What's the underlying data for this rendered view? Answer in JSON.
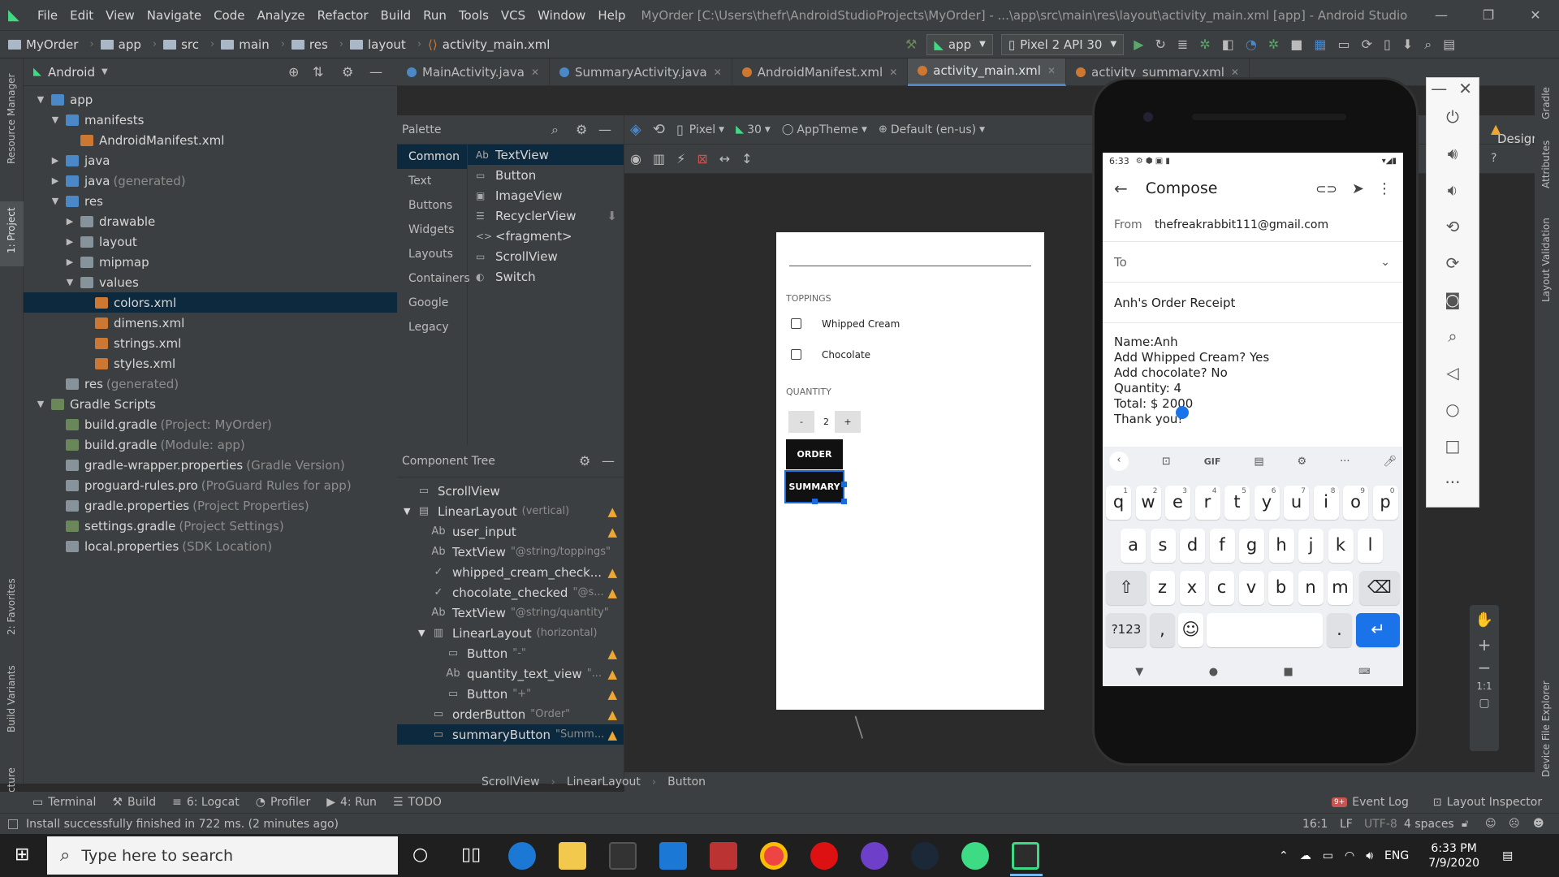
{
  "menu": {
    "items": [
      "File",
      "Edit",
      "View",
      "Navigate",
      "Code",
      "Analyze",
      "Refactor",
      "Build",
      "Run",
      "Tools",
      "VCS",
      "Window",
      "Help"
    ],
    "title": "MyOrder [C:\\Users\\thefr\\AndroidStudioProjects\\MyOrder] - ...\\app\\src\\main\\res\\layout\\activity_main.xml [app] - Android Studio"
  },
  "nav": {
    "crumbs": [
      "MyOrder",
      "app",
      "src",
      "main",
      "res",
      "layout",
      "activity_main.xml"
    ],
    "run_config": "app",
    "device": "Pixel 2 API 30"
  },
  "project": {
    "view": "Android",
    "tree": [
      {
        "label": "app",
        "extra": "",
        "depth": 0,
        "arrow": "▼",
        "type": "folder-blue"
      },
      {
        "label": "manifests",
        "extra": "",
        "depth": 1,
        "arrow": "▼",
        "type": "folder-blue"
      },
      {
        "label": "AndroidManifest.xml",
        "extra": "",
        "depth": 2,
        "arrow": "",
        "type": "xml"
      },
      {
        "label": "java",
        "extra": "",
        "depth": 1,
        "arrow": "▶",
        "type": "folder-blue"
      },
      {
        "label": "java",
        "extra": "(generated)",
        "depth": 1,
        "arrow": "▶",
        "type": "folder-blue"
      },
      {
        "label": "res",
        "extra": "",
        "depth": 1,
        "arrow": "▼",
        "type": "folder-blue"
      },
      {
        "label": "drawable",
        "extra": "",
        "depth": 2,
        "arrow": "▶",
        "type": "folder"
      },
      {
        "label": "layout",
        "extra": "",
        "depth": 2,
        "arrow": "▶",
        "type": "folder"
      },
      {
        "label": "mipmap",
        "extra": "",
        "depth": 2,
        "arrow": "▶",
        "type": "folder"
      },
      {
        "label": "values",
        "extra": "",
        "depth": 2,
        "arrow": "▼",
        "type": "folder"
      },
      {
        "label": "colors.xml",
        "extra": "",
        "depth": 3,
        "arrow": "",
        "type": "xml",
        "selected": true
      },
      {
        "label": "dimens.xml",
        "extra": "",
        "depth": 3,
        "arrow": "",
        "type": "xml"
      },
      {
        "label": "strings.xml",
        "extra": "",
        "depth": 3,
        "arrow": "",
        "type": "xml"
      },
      {
        "label": "styles.xml",
        "extra": "",
        "depth": 3,
        "arrow": "",
        "type": "xml"
      },
      {
        "label": "res",
        "extra": "(generated)",
        "depth": 1,
        "arrow": "",
        "type": "folder"
      },
      {
        "label": "Gradle Scripts",
        "extra": "",
        "depth": 0,
        "arrow": "▼",
        "type": "gradle"
      },
      {
        "label": "build.gradle",
        "extra": "(Project: MyOrder)",
        "depth": 1,
        "arrow": "",
        "type": "gradle"
      },
      {
        "label": "build.gradle",
        "extra": "(Module: app)",
        "depth": 1,
        "arrow": "",
        "type": "gradle"
      },
      {
        "label": "gradle-wrapper.properties",
        "extra": "(Gradle Version)",
        "depth": 1,
        "arrow": "",
        "type": "props"
      },
      {
        "label": "proguard-rules.pro",
        "extra": "(ProGuard Rules for app)",
        "depth": 1,
        "arrow": "",
        "type": "props"
      },
      {
        "label": "gradle.properties",
        "extra": "(Project Properties)",
        "depth": 1,
        "arrow": "",
        "type": "props"
      },
      {
        "label": "settings.gradle",
        "extra": "(Project Settings)",
        "depth": 1,
        "arrow": "",
        "type": "gradle"
      },
      {
        "label": "local.properties",
        "extra": "(SDK Location)",
        "depth": 1,
        "arrow": "",
        "type": "props"
      }
    ]
  },
  "tabs": [
    {
      "label": "MainActivity.java",
      "active": false,
      "color": "#4a88c7"
    },
    {
      "label": "SummaryActivity.java",
      "active": false,
      "color": "#4a88c7"
    },
    {
      "label": "AndroidManifest.xml",
      "active": false,
      "color": "#cc7832"
    },
    {
      "label": "activity_main.xml",
      "active": true,
      "color": "#cc7832"
    },
    {
      "label": "activity_summary.xml",
      "active": false,
      "color": "#cc7832"
    }
  ],
  "design_label": "Design",
  "palette": {
    "title": "Palette",
    "categories": [
      "Common",
      "Text",
      "Buttons",
      "Widgets",
      "Layouts",
      "Containers",
      "Google",
      "Legacy"
    ],
    "items": [
      {
        "icon": "Ab",
        "label": "TextView"
      },
      {
        "icon": "▭",
        "label": "Button"
      },
      {
        "icon": "▣",
        "label": "ImageView"
      },
      {
        "icon": "☰",
        "label": "RecyclerView"
      },
      {
        "icon": "<>",
        "label": "<fragment>"
      },
      {
        "icon": "▭",
        "label": "ScrollView"
      },
      {
        "icon": "◐",
        "label": "Switch"
      }
    ]
  },
  "design_toolbar": {
    "device": "Pixel",
    "api": "30",
    "theme": "AppTheme",
    "locale": "Default (en-us)"
  },
  "component_tree": {
    "title": "Component Tree",
    "items": [
      {
        "label": "ScrollView",
        "hint": "",
        "depth": 0,
        "icon": "▭",
        "warn": false
      },
      {
        "label": "LinearLayout",
        "hint": "(vertical)",
        "depth": 0,
        "icon": "▤",
        "arrow": "▼",
        "warn": true
      },
      {
        "label": "user_input",
        "hint": "",
        "depth": 1,
        "icon": "Ab",
        "warn": true
      },
      {
        "label": "TextView",
        "hint": "\"@string/toppings\"",
        "depth": 1,
        "icon": "Ab",
        "warn": false
      },
      {
        "label": "whipped_cream_check...",
        "hint": "",
        "depth": 1,
        "icon": "✓",
        "warn": true
      },
      {
        "label": "chocolate_checked",
        "hint": "\"@s...",
        "depth": 1,
        "icon": "✓",
        "warn": true
      },
      {
        "label": "TextView",
        "hint": "\"@string/quantity\"",
        "depth": 1,
        "icon": "Ab",
        "warn": false
      },
      {
        "label": "LinearLayout",
        "hint": "(horizontal)",
        "depth": 1,
        "icon": "▥",
        "arrow": "▼",
        "warn": false
      },
      {
        "label": "Button",
        "hint": "\"-\"",
        "depth": 2,
        "icon": "▭",
        "warn": true
      },
      {
        "label": "quantity_text_view",
        "hint": "\"...",
        "depth": 2,
        "icon": "Ab",
        "warn": true
      },
      {
        "label": "Button",
        "hint": "\"+\"",
        "depth": 2,
        "icon": "▭",
        "warn": true
      },
      {
        "label": "orderButton",
        "hint": "\"Order\"",
        "depth": 1,
        "icon": "▭",
        "warn": true
      },
      {
        "label": "summaryButton",
        "hint": "\"Summ...",
        "depth": 1,
        "icon": "▭",
        "warn": true,
        "selected": true
      }
    ]
  },
  "preview": {
    "toppings": "TOPPINGS",
    "whipped": "Whipped Cream",
    "chocolate": "Chocolate",
    "quantity_label": "QUANTITY",
    "minus": "-",
    "qty": "2",
    "plus": "+",
    "order": "ORDER",
    "summary": "SUMMARY"
  },
  "bottom_breadcrumb": [
    "ScrollView",
    "LinearLayout",
    "Button"
  ],
  "tool_windows": [
    "Terminal",
    "Build",
    "6: Logcat",
    "Profiler",
    "4: Run",
    "TODO"
  ],
  "tool_windows_right": [
    "Event Log",
    "Layout Inspector"
  ],
  "status": {
    "message": "Install successfully finished in 722 ms. (2 minutes ago)",
    "position": "16:1",
    "lf": "LF",
    "encoding": "UTF-8",
    "indent": "4 spaces"
  },
  "left_strip": [
    "Resource Manager",
    "1: Project",
    "2: Favorites",
    "Build Variants",
    "Z: Structure"
  ],
  "right_strip": [
    "Gradle",
    "Attributes",
    "Layout Validation",
    "Device File Explorer"
  ],
  "phone": {
    "time": "6:33",
    "compose": {
      "title": "Compose",
      "from_label": "From",
      "from": "thefreakrabbit111@gmail.com",
      "to_label": "To",
      "subject": "Anh's Order Receipt",
      "body": [
        "Name:Anh",
        "Add Whipped Cream? Yes",
        "Add chocolate? No",
        "Quantity: 4",
        "Total: $ 2000",
        "Thank you!"
      ]
    },
    "kb_row1": [
      [
        "q",
        "1"
      ],
      [
        "w",
        "2"
      ],
      [
        "e",
        "3"
      ],
      [
        "r",
        "4"
      ],
      [
        "t",
        "5"
      ],
      [
        "y",
        "6"
      ],
      [
        "u",
        "7"
      ],
      [
        "i",
        "8"
      ],
      [
        "o",
        "9"
      ],
      [
        "p",
        "0"
      ]
    ],
    "kb_row2": [
      "a",
      "s",
      "d",
      "f",
      "g",
      "h",
      "j",
      "k",
      "l"
    ],
    "kb_row3": [
      "z",
      "x",
      "c",
      "v",
      "b",
      "n",
      "m"
    ],
    "kb_sym": "?123",
    "kb_comma": ",",
    "kb_period": ".",
    "kb_gif": "GIF"
  },
  "taskbar": {
    "search_placeholder": "Type here to search",
    "time": "6:33 PM",
    "date": "7/9/2020",
    "lang": "ENG"
  }
}
